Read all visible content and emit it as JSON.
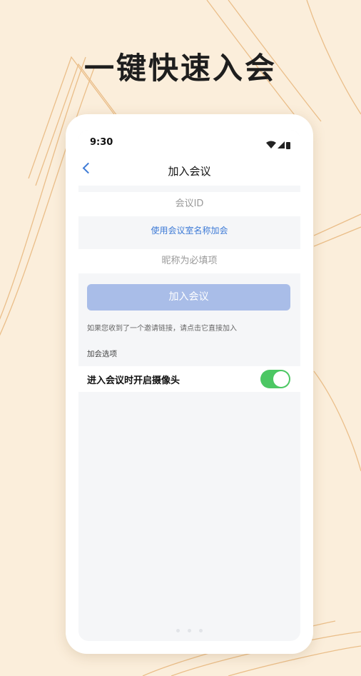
{
  "headline": "一键快速入会",
  "status_bar": {
    "time": "9:30"
  },
  "nav": {
    "title": "加入会议"
  },
  "form": {
    "meeting_id_placeholder": "会议ID",
    "use_room_name_link": "使用会议室名称加会",
    "nickname_placeholder": "昵称为必填项",
    "join_button": "加入会议",
    "invite_hint": "如果您收到了一个邀请链接，请点击它直接加入"
  },
  "options": {
    "section_title": "加会选项",
    "camera_on_label": "进入会议时开启摄像头",
    "camera_on": true
  },
  "colors": {
    "background": "#fbeedb",
    "accent": "#3d7ad6",
    "button_disabled": "#a9bde8",
    "toggle_on": "#4cc763"
  },
  "icons": [
    "wifi-icon",
    "signal-icon",
    "battery-icon",
    "back-arrow-icon"
  ]
}
